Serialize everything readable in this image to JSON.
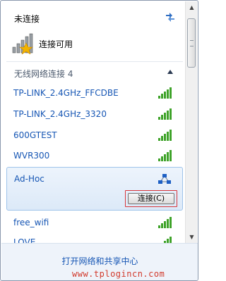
{
  "status": {
    "title": "未连接",
    "connect_available_label": "连接可用"
  },
  "group": {
    "header": "无线网络连接 4"
  },
  "networks": [
    {
      "name": "TP-LINK_2.4GHz_FFCDBE"
    },
    {
      "name": "TP-LINK_2.4GHz_3320"
    },
    {
      "name": "600GTEST"
    },
    {
      "name": "WVR300"
    },
    {
      "name": "Ad-Hoc",
      "connect_label": "连接(C)"
    },
    {
      "name": "free_wifi"
    },
    {
      "name": "LOVE"
    }
  ],
  "footer": {
    "link": "打开网络和共享中心",
    "watermark": "www.tplogincn.com"
  },
  "icons": {
    "refresh": "refresh-icon",
    "signal": "wifi-signal-icon",
    "adhoc": "adhoc-network-icon",
    "collapse": "chevron-up-icon"
  },
  "colors": {
    "link": "#1656b4",
    "signal_green": "#3fa32a",
    "selected_bg": "#dce9f8",
    "highlight_border": "#d8363a"
  }
}
